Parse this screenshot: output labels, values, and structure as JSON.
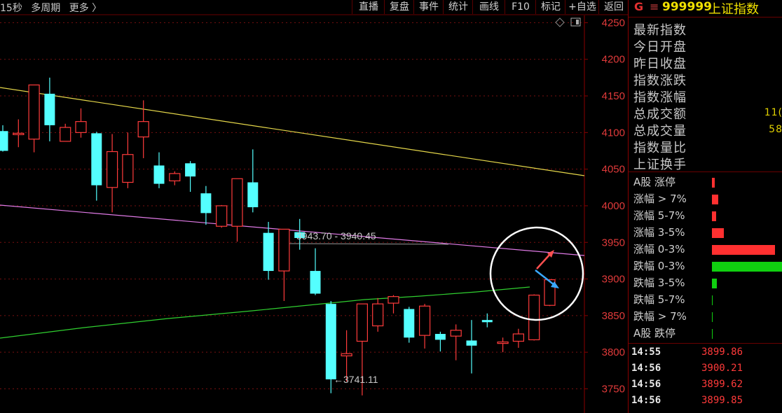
{
  "toolbar": {
    "left_items": [
      "15秒",
      "多周期",
      "更多 〉"
    ],
    "buttons": [
      "直播",
      "复盘",
      "事件",
      "统计",
      "画线",
      "F10",
      "标记",
      "+自选",
      "返回"
    ]
  },
  "chart_data": {
    "type": "candlestick",
    "y_ticks": [
      4250,
      4200,
      4150,
      4100,
      4050,
      4000,
      3950,
      3900,
      3850,
      3800,
      3750
    ],
    "ylim": [
      3717,
      4281
    ],
    "up_color": "#ff3b3b",
    "down_color": "#54ffff",
    "candles": [
      {
        "o": 4102,
        "h": 4110,
        "l": 4074,
        "c": 4075
      },
      {
        "o": 4098,
        "h": 4118,
        "l": 4080,
        "c": 4099
      },
      {
        "o": 4091,
        "h": 4156,
        "l": 4073,
        "c": 4165
      },
      {
        "o": 4153,
        "h": 4175,
        "l": 4088,
        "c": 4110
      },
      {
        "o": 4088,
        "h": 4112,
        "l": 4088,
        "c": 4107
      },
      {
        "o": 4100,
        "h": 4133,
        "l": 4093,
        "c": 4115
      },
      {
        "o": 4099,
        "h": 4101,
        "l": 4007,
        "c": 4028
      },
      {
        "o": 4025,
        "h": 4098,
        "l": 3991,
        "c": 4074
      },
      {
        "o": 4032,
        "h": 4100,
        "l": 4024,
        "c": 4070
      },
      {
        "o": 4094,
        "h": 4144,
        "l": 4065,
        "c": 4115
      },
      {
        "o": 4055,
        "h": 4073,
        "l": 4024,
        "c": 4030
      },
      {
        "o": 4034,
        "h": 4047,
        "l": 4028,
        "c": 4044
      },
      {
        "o": 4058,
        "h": 4061,
        "l": 4019,
        "c": 4040
      },
      {
        "o": 4017,
        "h": 4027,
        "l": 3974,
        "c": 3990
      },
      {
        "o": 3972,
        "h": 4001,
        "l": 3970,
        "c": 4000
      },
      {
        "o": 3972,
        "h": 4003,
        "l": 3951,
        "c": 4037
      },
      {
        "o": 4032,
        "h": 4077,
        "l": 3991,
        "c": 3998
      },
      {
        "o": 3963,
        "h": 3978,
        "l": 3899,
        "c": 3911
      },
      {
        "o": 3911,
        "h": 3965,
        "l": 3870,
        "c": 3968
      },
      {
        "o": 3964,
        "h": 3982,
        "l": 3940,
        "c": 3956
      },
      {
        "o": 3911,
        "h": 3942,
        "l": 3878,
        "c": 3880
      },
      {
        "o": 3866,
        "h": 3870,
        "l": 3744,
        "c": 3763
      },
      {
        "o": 3795,
        "h": 3830,
        "l": 3760,
        "c": 3798
      },
      {
        "o": 3815,
        "h": 3866,
        "l": 3741,
        "c": 3866
      },
      {
        "o": 3836,
        "h": 3874,
        "l": 3828,
        "c": 3866
      },
      {
        "o": 3867,
        "h": 3878,
        "l": 3853,
        "c": 3876
      },
      {
        "o": 3859,
        "h": 3862,
        "l": 3813,
        "c": 3820
      },
      {
        "o": 3823,
        "h": 3866,
        "l": 3805,
        "c": 3863
      },
      {
        "o": 3825,
        "h": 3828,
        "l": 3801,
        "c": 3817
      },
      {
        "o": 3822,
        "h": 3838,
        "l": 3789,
        "c": 3830
      },
      {
        "o": 3816,
        "h": 3844,
        "l": 3771,
        "c": 3809
      },
      {
        "o": 3844,
        "h": 3853,
        "l": 3834,
        "c": 3841
      },
      {
        "o": 3812,
        "h": 3820,
        "l": 3800,
        "c": 3814
      },
      {
        "o": 3815,
        "h": 3832,
        "l": 3806,
        "c": 3825
      },
      {
        "o": 3817,
        "h": 3879,
        "l": 3816,
        "c": 3878
      },
      {
        "o": 3864,
        "h": 3900,
        "l": 3863,
        "c": 3899
      }
    ],
    "annotations": {
      "range_label": "3943.70 - 3940.45",
      "low_label": "←3741.11"
    }
  },
  "side_panel": {
    "header": {
      "logo": "G",
      "menu_icon": "≡",
      "code": "999999",
      "name": "上证指数"
    },
    "stats": [
      {
        "label": "最新指数",
        "value": ""
      },
      {
        "label": "今日开盘",
        "value": ""
      },
      {
        "label": "昨日收盘",
        "value": ""
      },
      {
        "label": "指数涨跌",
        "value": ""
      },
      {
        "label": "指数涨幅",
        "value": ""
      },
      {
        "label": "总成交额",
        "value": "11("
      },
      {
        "label": "总成交量",
        "value": "58"
      },
      {
        "label": "指数量比",
        "value": ""
      },
      {
        "label": "上证换手",
        "value": ""
      }
    ],
    "distribution": [
      {
        "label": "A股 涨停",
        "level": 0.04,
        "color": "#ff3030"
      },
      {
        "label": "涨幅 > 7%",
        "level": 0.09,
        "color": "#ff3030"
      },
      {
        "label": "涨幅 5-7%",
        "level": 0.06,
        "color": "#ff3030"
      },
      {
        "label": "涨幅 3-5%",
        "level": 0.17,
        "color": "#ff3030"
      },
      {
        "label": "涨幅 0-3%",
        "level": 0.89,
        "color": "#ff3030"
      },
      {
        "label": "跌幅 0-3%",
        "level": 1.0,
        "color": "#10d010"
      },
      {
        "label": "跌幅 3-5%",
        "level": 0.07,
        "color": "#10d010"
      },
      {
        "label": "跌幅 5-7%",
        "level": 0.01,
        "color": "#10d010"
      },
      {
        "label": "跌幅 > 7%",
        "level": 0.01,
        "color": "#10d010"
      },
      {
        "label": "A股 跌停",
        "level": 0.01,
        "color": "#10d010"
      }
    ],
    "ticks": [
      {
        "time": "14:55",
        "value": "3899.86"
      },
      {
        "time": "14:56",
        "value": "3900.21"
      },
      {
        "time": "14:56",
        "value": "3899.62"
      },
      {
        "time": "14:56",
        "value": "3899.85"
      }
    ]
  }
}
